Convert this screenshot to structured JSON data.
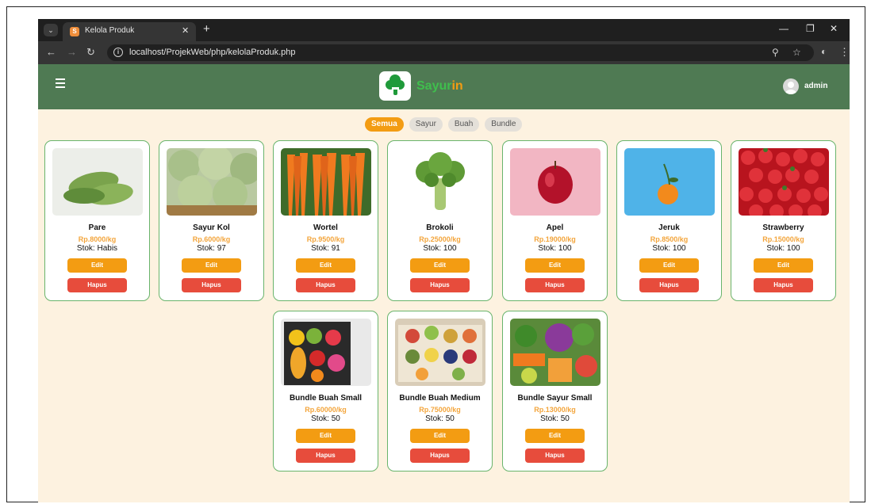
{
  "browser": {
    "tab_title": "Kelola Produk",
    "url": "localhost/ProjekWeb/php/kelolaProduk.php"
  },
  "header": {
    "logo_part1": "Sayur",
    "logo_part2": "in",
    "user": "admin"
  },
  "filters": [
    {
      "label": "Semua",
      "active": true
    },
    {
      "label": "Sayur",
      "active": false
    },
    {
      "label": "Buah",
      "active": false
    },
    {
      "label": "Bundle",
      "active": false
    }
  ],
  "buttons": {
    "edit": "Edit",
    "delete": "Hapus"
  },
  "products": [
    {
      "name": "Pare",
      "price": "Rp.8000/kg",
      "stock": "Stok: Habis",
      "image": "bitter-melon"
    },
    {
      "name": "Sayur Kol",
      "price": "Rp.6000/kg",
      "stock": "Stok: 97",
      "image": "cabbage"
    },
    {
      "name": "Wortel",
      "price": "Rp.9500/kg",
      "stock": "Stok: 91",
      "image": "carrot"
    },
    {
      "name": "Brokoli",
      "price": "Rp.25000/kg",
      "stock": "Stok: 100",
      "image": "broccoli"
    },
    {
      "name": "Apel",
      "price": "Rp.19000/kg",
      "stock": "Stok: 100",
      "image": "apple"
    },
    {
      "name": "Jeruk",
      "price": "Rp.8500/kg",
      "stock": "Stok: 100",
      "image": "orange"
    },
    {
      "name": "Strawberry",
      "price": "Rp.15000/kg",
      "stock": "Stok: 100",
      "image": "strawberry"
    },
    {
      "name": "Bundle Buah Small",
      "price": "Rp.60000/kg",
      "stock": "Stok: 50",
      "image": "fruit-box"
    },
    {
      "name": "Bundle Buah Medium",
      "price": "Rp.75000/kg",
      "stock": "Stok: 50",
      "image": "fruit-box-medium"
    },
    {
      "name": "Bundle Sayur Small",
      "price": "Rp.13000/kg",
      "stock": "Stok: 50",
      "image": "vegetable-box"
    }
  ]
}
